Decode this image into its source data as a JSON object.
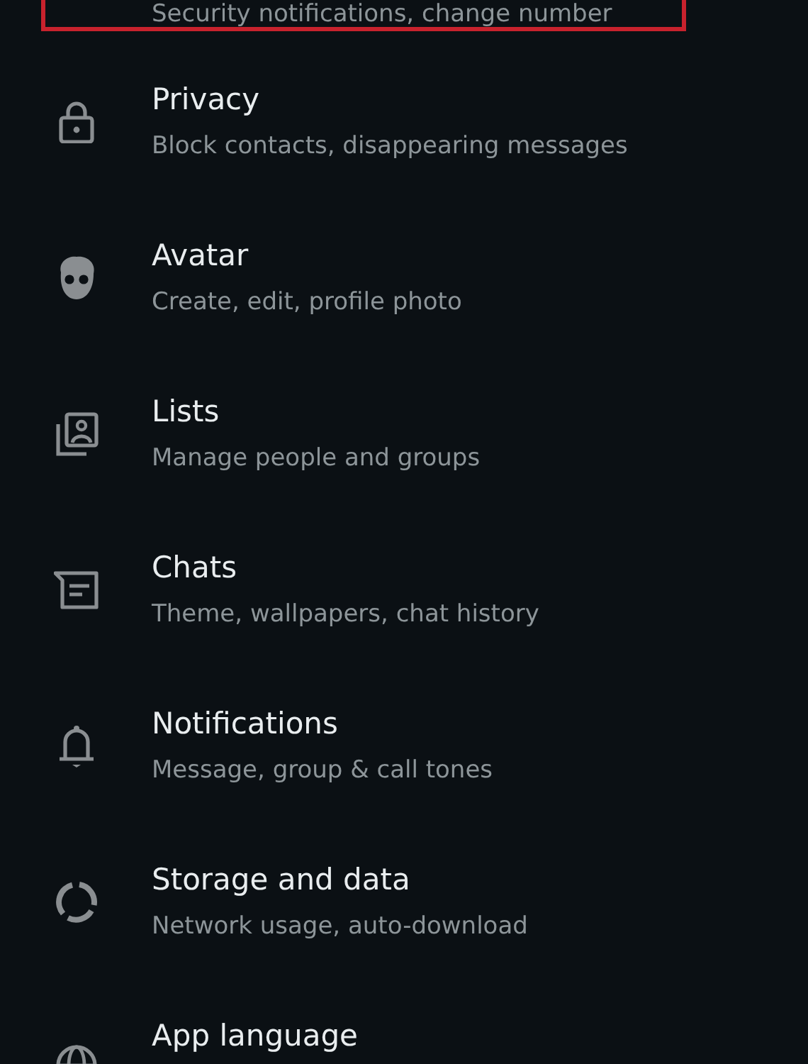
{
  "highlighted_row": {
    "subtitle": "Security notifications, change number"
  },
  "items": [
    {
      "title": "Privacy",
      "subtitle": "Block contacts, disappearing messages"
    },
    {
      "title": "Avatar",
      "subtitle": "Create, edit, profile photo"
    },
    {
      "title": "Lists",
      "subtitle": "Manage people and groups"
    },
    {
      "title": "Chats",
      "subtitle": "Theme, wallpapers, chat history"
    },
    {
      "title": "Notifications",
      "subtitle": "Message, group & call tones"
    },
    {
      "title": "Storage and data",
      "subtitle": "Network usage, auto-download"
    },
    {
      "title": "App language"
    }
  ]
}
